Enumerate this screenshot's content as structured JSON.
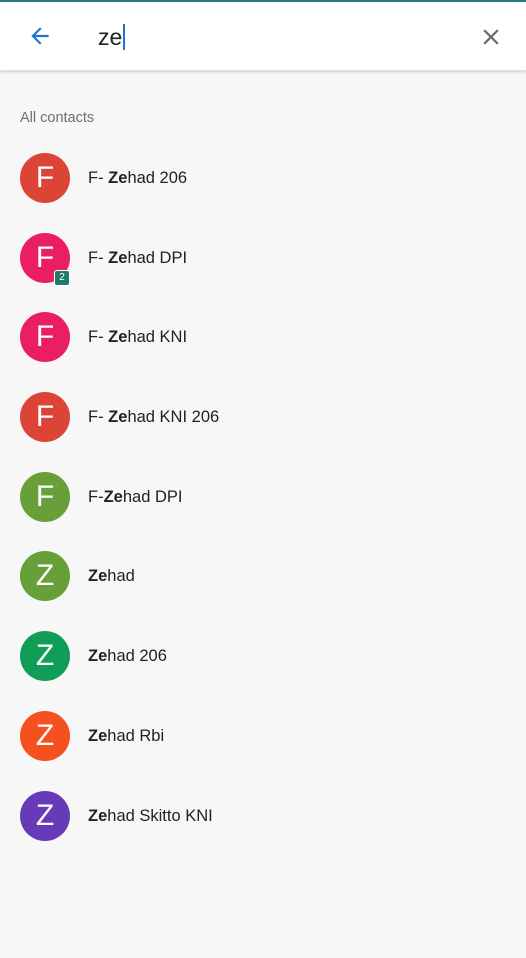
{
  "search": {
    "query": "ze"
  },
  "section_title": "All contacts",
  "icons": {
    "back": "arrow-left-icon",
    "clear": "close-icon"
  },
  "colors": {
    "accent": "#1976d2"
  },
  "contacts": [
    {
      "initial": "F",
      "color": "#db4437",
      "prefix": "F- ",
      "match": "Ze",
      "suffix": "had 206"
    },
    {
      "initial": "F",
      "color": "#e91e63",
      "prefix": "F- ",
      "match": "Ze",
      "suffix": "had DPI",
      "badge": "2"
    },
    {
      "initial": "F",
      "color": "#e91e63",
      "prefix": "F- ",
      "match": "Ze",
      "suffix": "had KNI"
    },
    {
      "initial": "F",
      "color": "#db4437",
      "prefix": "F- ",
      "match": "Ze",
      "suffix": "had KNI 206"
    },
    {
      "initial": "F",
      "color": "#689f38",
      "prefix": "F-",
      "match": "Ze",
      "suffix": "had DPI"
    },
    {
      "initial": "Z",
      "color": "#689f38",
      "prefix": "",
      "match": "Ze",
      "suffix": "had"
    },
    {
      "initial": "Z",
      "color": "#0f9d58",
      "prefix": "",
      "match": "Ze",
      "suffix": "had 206"
    },
    {
      "initial": "Z",
      "color": "#f4511e",
      "prefix": "",
      "match": "Ze",
      "suffix": "had Rbi"
    },
    {
      "initial": "Z",
      "color": "#673ab7",
      "prefix": "",
      "match": "Ze",
      "suffix": "had Skitto KNI"
    }
  ]
}
